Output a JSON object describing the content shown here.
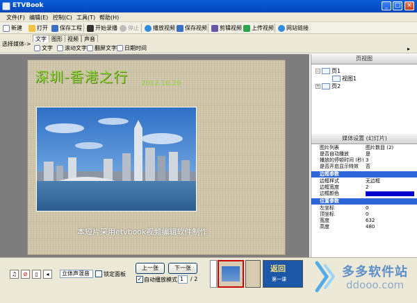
{
  "window": {
    "title": "ETVBook"
  },
  "menu": [
    "文件(F)",
    "编辑(E)",
    "控制(C)",
    "工具(T)",
    "帮助(H)"
  ],
  "toolbar": {
    "new": "新建",
    "open": "打开",
    "save_project": "保存工程",
    "start_record": "开始录播",
    "stop": "停止",
    "play_video": "播放视频",
    "save_video": "保存视频",
    "cut_video": "剪辑视频",
    "upload_video": "上传视频",
    "site_link": "网站链接"
  },
  "media_select_label": "选择媒体->",
  "tabs": [
    "文字",
    "图形",
    "视频",
    "声音"
  ],
  "text_tools": [
    "文字",
    "滚动文字",
    "翻屏文字",
    "日期时间"
  ],
  "slide": {
    "title": "深圳-香港之行",
    "date": "2012.10.20",
    "caption": "本短片采用etvbook视频编辑软件制作"
  },
  "page_tree": {
    "header": "页视图",
    "items": [
      "页1",
      "视图1",
      "页2"
    ]
  },
  "media_settings": {
    "header": "媒体设置 (幻灯片)",
    "rows": [
      {
        "key": "图片列表",
        "value": "图片数目 (2)"
      },
      {
        "key": "是否自动播放",
        "value": "是"
      },
      {
        "key": "播放的停顿时间 (秒)",
        "value": "3"
      },
      {
        "key": "是否开启显示特效",
        "value": "否"
      }
    ],
    "border_section": "边框参数",
    "border_rows": [
      {
        "key": "边框样式",
        "value": "无边框"
      },
      {
        "key": "边框宽度",
        "value": "2"
      },
      {
        "key": "边框颜色",
        "value": ""
      }
    ],
    "border_color": "#0000cc",
    "position_section": "位置参数",
    "position_rows": [
      {
        "key": "左坐标",
        "value": "0"
      },
      {
        "key": "顶坐标",
        "value": "0"
      },
      {
        "key": "宽度",
        "value": "632"
      },
      {
        "key": "高度",
        "value": "480"
      }
    ]
  },
  "bottom": {
    "audio_mode": "立体声混音",
    "lock_panel": "锁定面板",
    "prev": "上一张",
    "next": "下一张",
    "auto_play": "自动播放模式",
    "page_current": "1",
    "page_total": "/ 2",
    "thumb_return": "返回",
    "thumb_sub": "第一课"
  },
  "watermark": {
    "brand": "多多软件站",
    "url": "ddooo.com"
  },
  "colors": {
    "title_bar": "#0a5fd8",
    "section": "#2d66d9",
    "slide_text": "#8bd23a"
  }
}
